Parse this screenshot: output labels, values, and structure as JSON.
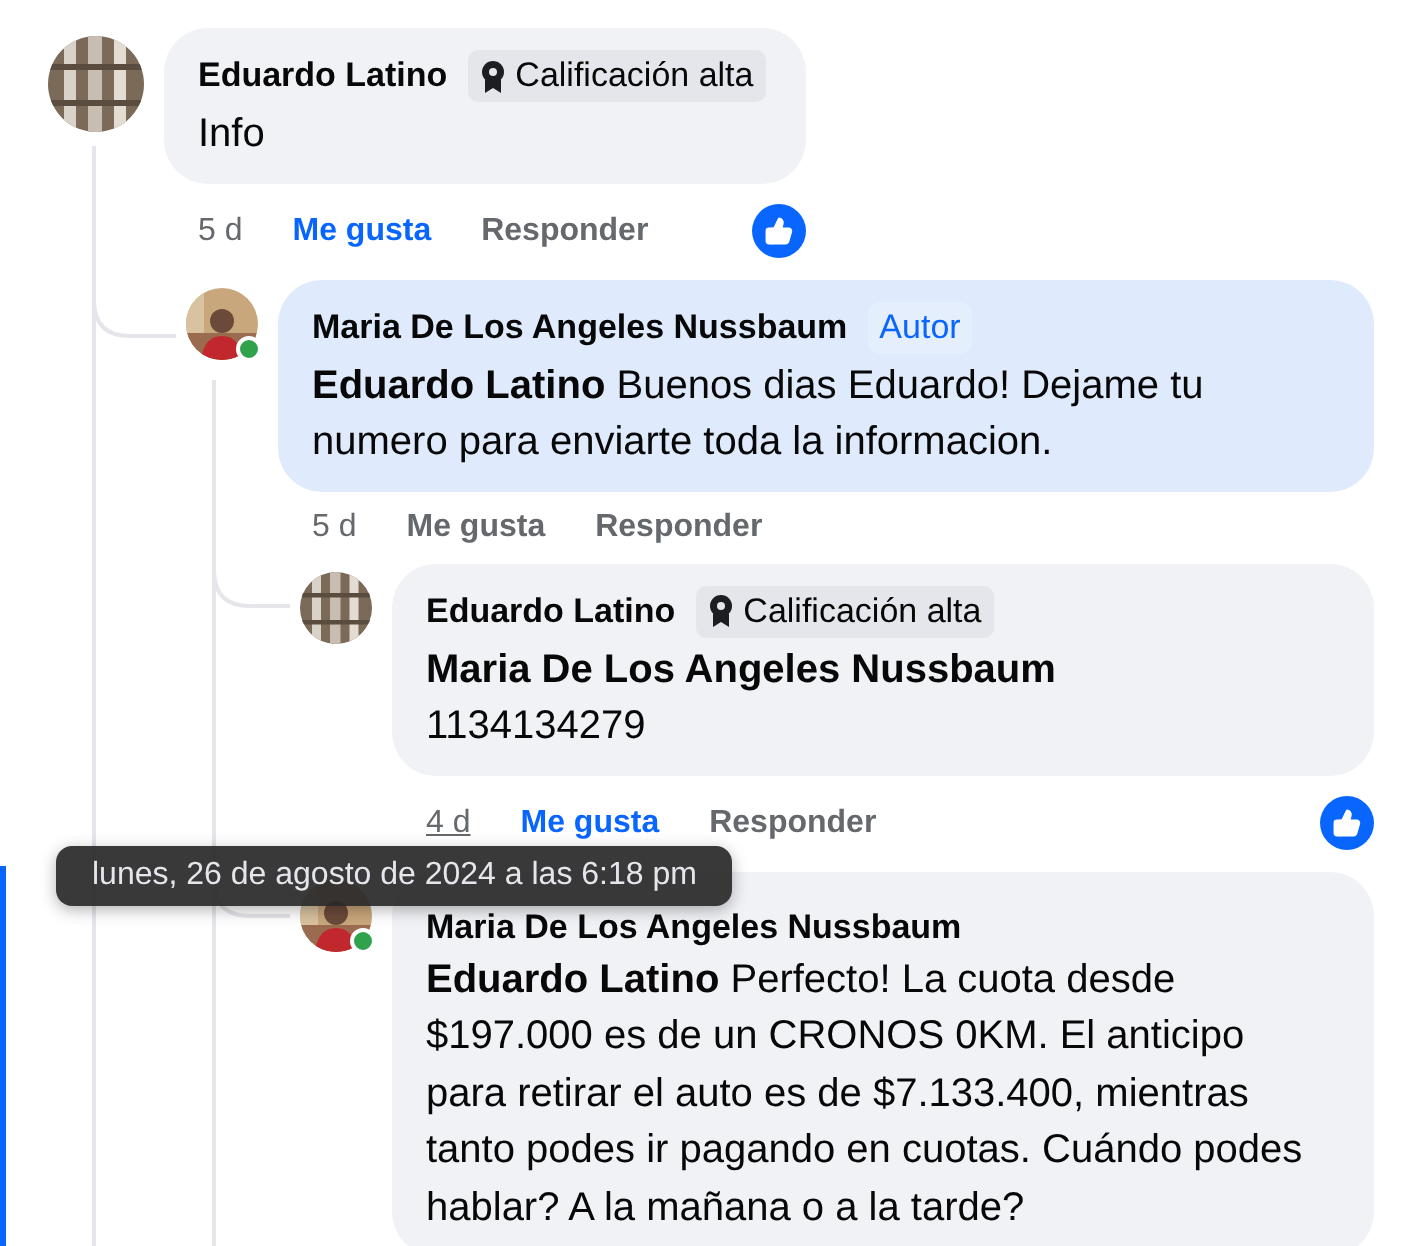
{
  "comments": [
    {
      "author": "Eduardo Latino",
      "online": false,
      "badge": {
        "kind": "rating",
        "label": "Calificación alta"
      },
      "body": "Info",
      "highlighted": false,
      "time": "5 d",
      "time_hovered": false,
      "like_label": "Me gusta",
      "liked": true,
      "reply_label": "Responder",
      "children": [
        {
          "author": "Maria De Los Angeles Nussbaum",
          "online": true,
          "badge": {
            "kind": "author",
            "label": "Autor"
          },
          "body": "**Eduardo Latino** Buenos dias Eduardo! Dejame tu numero para enviarte toda la informacion.",
          "highlighted": true,
          "time": "5 d",
          "time_hovered": false,
          "like_label": "Me gusta",
          "liked": false,
          "reply_label": "Responder",
          "children": [
            {
              "author": "Eduardo Latino",
              "online": false,
              "badge": {
                "kind": "rating",
                "label": "Calificación alta"
              },
              "body": "**Maria De Los Angeles Nussbaum**\n1134134279",
              "highlighted": false,
              "time": "4 d",
              "time_hovered": true,
              "like_label": "Me gusta",
              "liked": true,
              "reply_label": "Responder"
            },
            {
              "author": "Maria De Los Angeles Nussbaum",
              "online": true,
              "body": "**Eduardo Latino** Perfecto! La cuota desde $197.000 es de un CRONOS 0KM. El anticipo para retirar el auto es de $7.133.400, mientras tanto podes ir pagando en cuotas. Cuándo podes hablar? A la mañana o a la tarde?",
              "highlighted": false
            }
          ]
        }
      ]
    }
  ],
  "tooltip": {
    "text": "lunes, 26 de agosto de 2024 a las 6:18 pm"
  }
}
